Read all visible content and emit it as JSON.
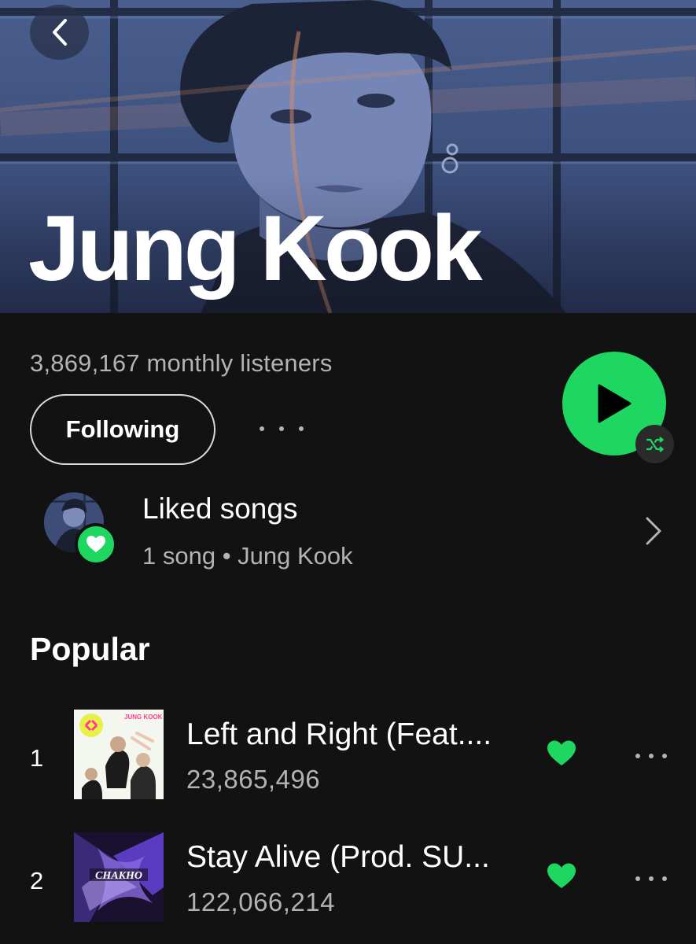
{
  "header": {
    "artist_name": "Jung Kook",
    "back_icon": "chevron-left-icon"
  },
  "stats": {
    "monthly_listeners": "3,869,167 monthly listeners"
  },
  "actions": {
    "follow_label": "Following",
    "more_icon": "more-horizontal-icon",
    "play_icon": "play-icon",
    "shuffle_icon": "shuffle-icon",
    "accent_color": "#1ed760"
  },
  "liked_songs": {
    "title": "Liked songs",
    "subtitle": "1 song • Jung Kook",
    "badge_icon": "heart-icon",
    "chevron_icon": "chevron-right-icon"
  },
  "popular": {
    "section_title": "Popular",
    "tracks": [
      {
        "rank": "1",
        "title": "Left and Right (Feat....",
        "plays": "23,865,496",
        "liked": true
      },
      {
        "rank": "2",
        "title": "Stay Alive (Prod. SU...",
        "plays": "122,066,214",
        "liked": true
      }
    ]
  },
  "covers": {
    "track_1_art_text": "JUNG KOOK",
    "track_2_art_text": "CHAKHO"
  }
}
